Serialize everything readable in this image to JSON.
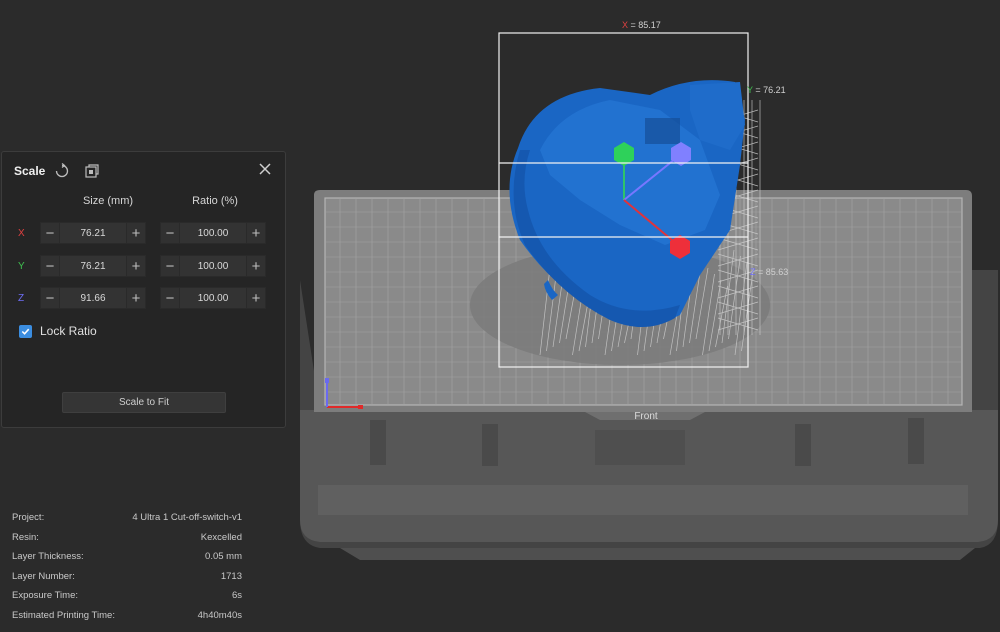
{
  "scale_panel": {
    "title": "Scale",
    "columns": {
      "size": "Size (mm)",
      "ratio": "Ratio (%)"
    },
    "rows": [
      {
        "axis": "X",
        "axis_color": "#e04040",
        "size": "76.21",
        "ratio": "100.00"
      },
      {
        "axis": "Y",
        "axis_color": "#3fbf4f",
        "size": "76.21",
        "ratio": "100.00"
      },
      {
        "axis": "Z",
        "axis_color": "#6d6df5",
        "size": "91.66",
        "ratio": "100.00"
      }
    ],
    "lock_ratio": {
      "label": "Lock Ratio",
      "checked": true
    },
    "scale_to_fit": "Scale to Fit",
    "icons": [
      "reset-icon",
      "copy-icon",
      "close-icon"
    ]
  },
  "project_info": [
    {
      "label": "Project:",
      "value": "4 Ultra 1 Cut-off-switch-v1"
    },
    {
      "label": "Resin:",
      "value": "Kexcelled"
    },
    {
      "label": "Layer Thickness:",
      "value": "0.05 mm"
    },
    {
      "label": "Layer Number:",
      "value": "1713"
    },
    {
      "label": "Exposure Time:",
      "value": "6s"
    },
    {
      "label": "Estimated Printing Time:",
      "value": "4h40m40s"
    }
  ],
  "dimensions": {
    "x": {
      "axis": "X",
      "value": "= 85.17"
    },
    "y": {
      "axis": "Y",
      "value": "= 76.21"
    },
    "z": {
      "axis": "Z",
      "value": "= 85.63"
    }
  },
  "plate_label": "Front",
  "colors": {
    "accent": "#3b8de0",
    "model": "#1a66c4",
    "background": "#2b2b2b"
  }
}
